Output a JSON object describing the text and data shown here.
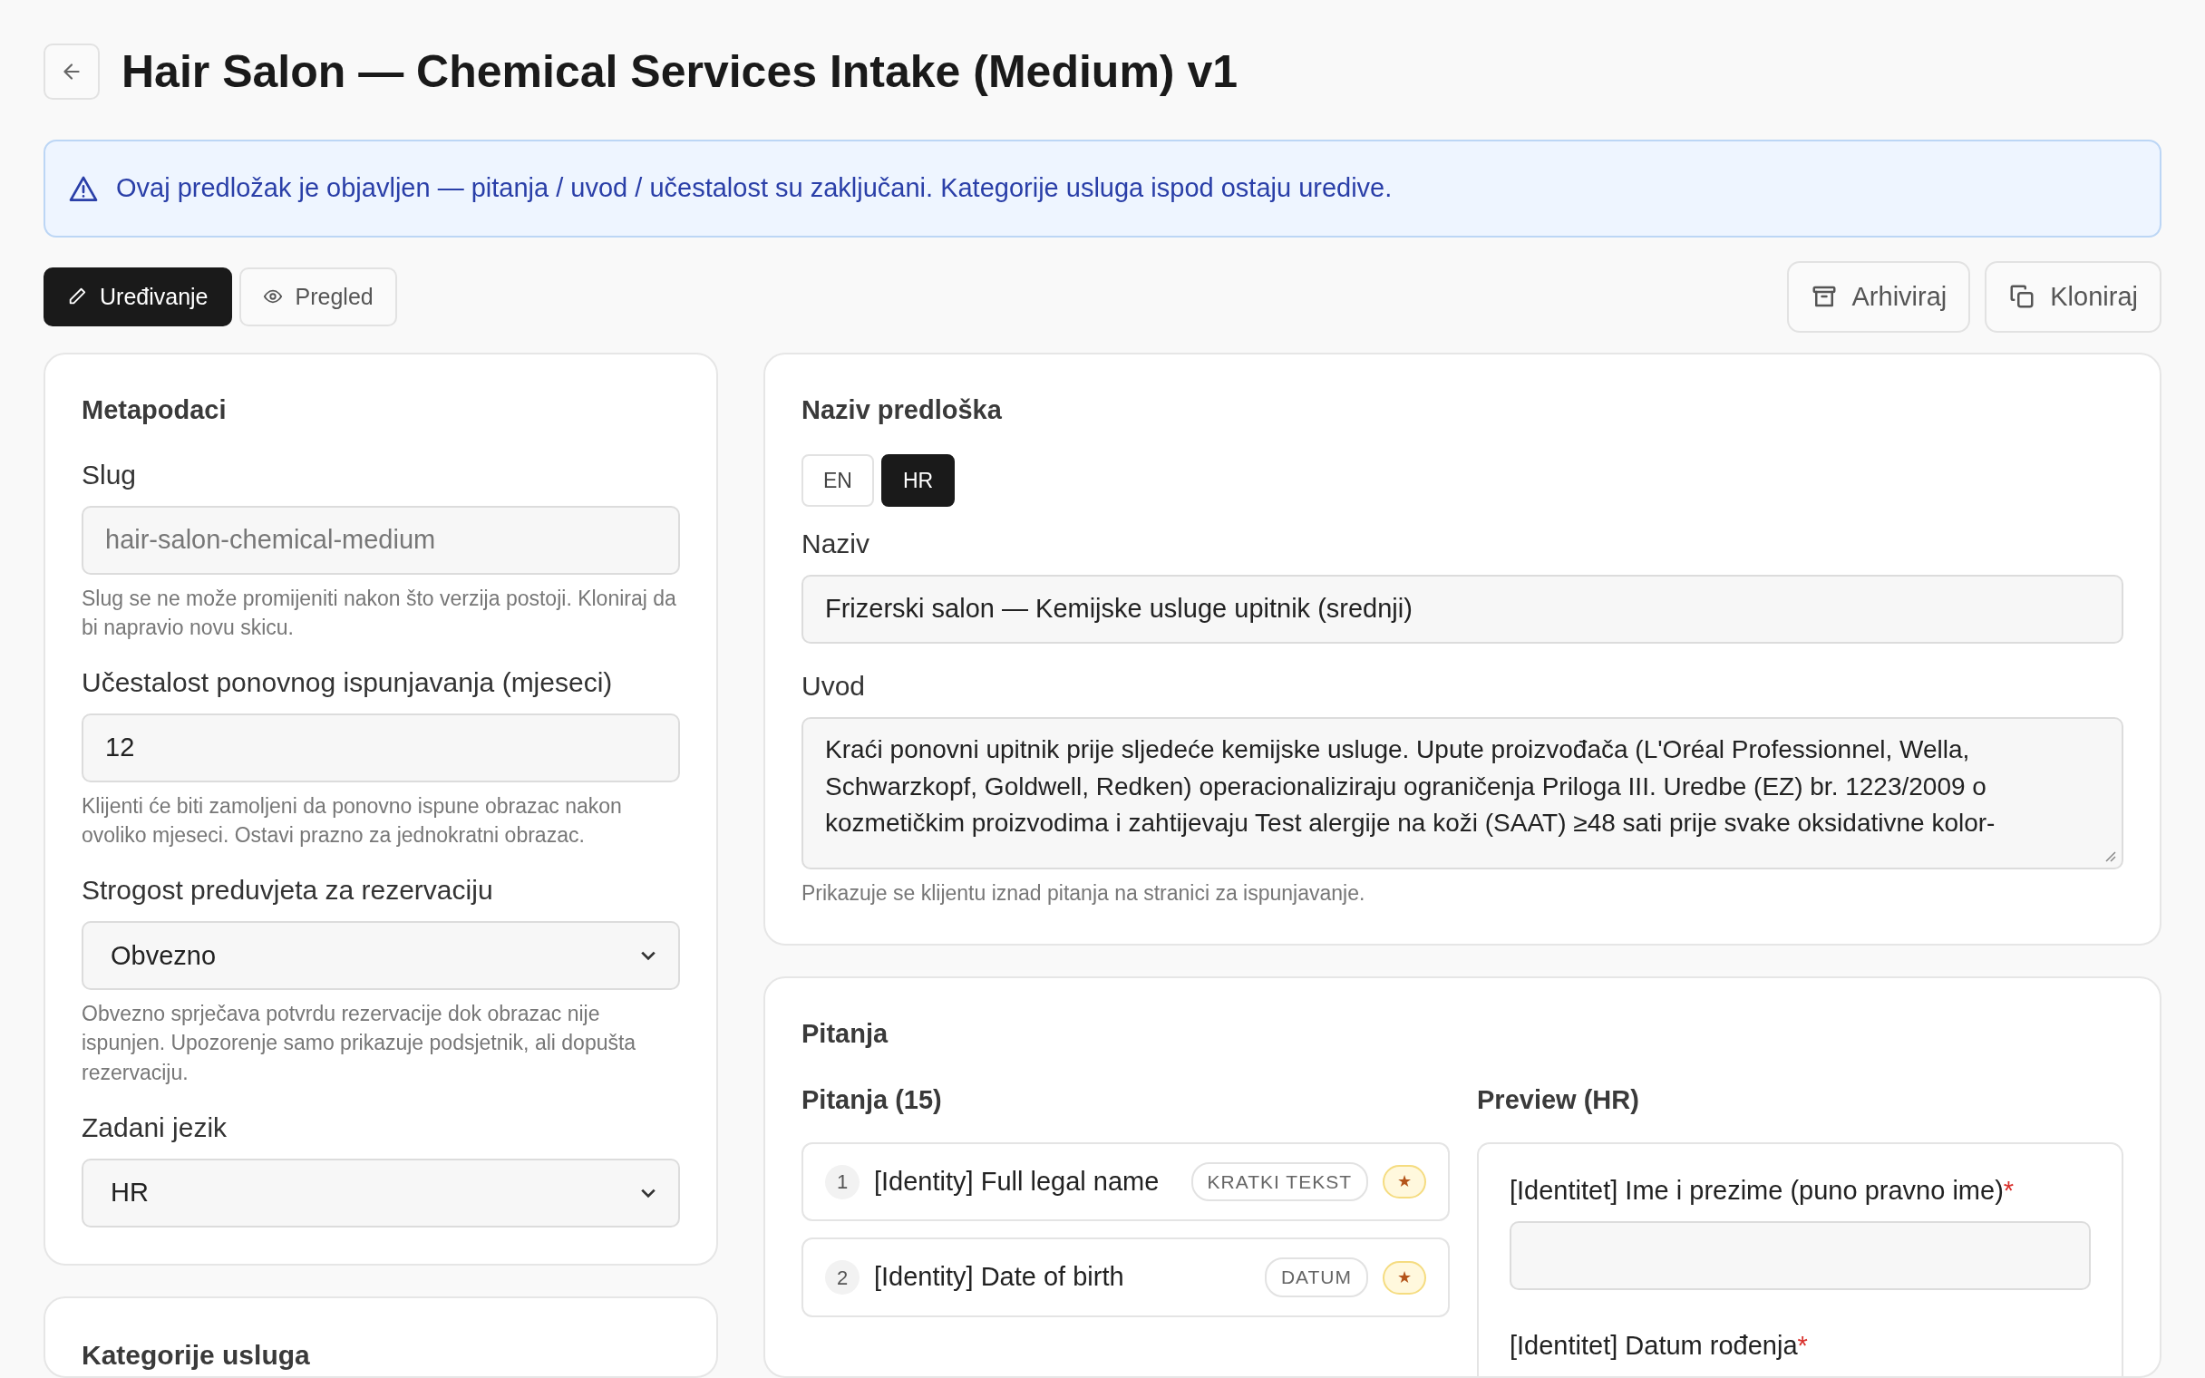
{
  "header": {
    "title": "Hair Salon — Chemical Services Intake (Medium) v1"
  },
  "alert": {
    "text": "Ovaj predložak je objavljen — pitanja / uvod / učestalost su zaključani. Kategorije usluga ispod ostaju uredive."
  },
  "mode_tabs": [
    {
      "label": "Uređivanje",
      "selected": true
    },
    {
      "label": "Pregled",
      "selected": false
    }
  ],
  "actions": [
    {
      "label": "Arhiviraj"
    },
    {
      "label": "Kloniraj"
    }
  ],
  "metadata": {
    "title": "Metapodaci",
    "fields": [
      {
        "kind": "input",
        "label": "Slug",
        "value": "hair-salon-chemical-medium",
        "disabled": true,
        "help": "Slug se ne može promijeniti nakon što verzija postoji. Kloniraj da bi napravio novu skicu."
      },
      {
        "kind": "input",
        "label": "Učestalost ponovnog ispunjavanja (mjeseci)",
        "value": "12",
        "help": "Klijenti će biti zamoljeni da ponovno ispune obrazac nakon ovoliko mjeseci. Ostavi prazno za jednokratni obrazac."
      },
      {
        "kind": "select",
        "label": "Strogost preduvjeta za rezervaciju",
        "value": "Obvezno",
        "help": "Obvezno sprječava potvrdu rezervacije dok obrazac nije ispunjen. Upozorenje samo prikazuje podsjetnik, ali dopušta rezervaciju."
      },
      {
        "kind": "select",
        "label": "Zadani jezik",
        "value": "HR"
      }
    ]
  },
  "categories": {
    "title": "Kategorije usluga"
  },
  "template_name": {
    "title": "Naziv predloška",
    "languages": [
      {
        "label": "EN",
        "selected": false
      },
      {
        "label": "HR",
        "selected": true
      }
    ],
    "name_label": "Naziv",
    "name_value": "Frizerski salon — Kemijske usluge upitnik (srednji)",
    "intro_label": "Uvod",
    "intro_value": "Kraći ponovni upitnik prije sljedeće kemijske usluge. Upute proizvođača (L'Oréal Professionnel, Wella, Schwarzkopf, Goldwell, Redken) operacionaliziraju ograničenja Priloga III. Uredbe (EZ) br. 1223/2009 o kozmetičkim proizvodima i zahtijevaju Test alergije na koži (SAAT) ≥48 sati prije svake oksidativne kolor-",
    "intro_help": "Prikazuje se klijentu iznad pitanja na stranici za ispunjavanje."
  },
  "questions": {
    "title": "Pitanja",
    "list_title": "Pitanja (15)",
    "items": [
      {
        "number": "1",
        "label": "[Identity] Full legal name",
        "type": "KRATKI TEKST",
        "required": true,
        "star": "★"
      },
      {
        "number": "2",
        "label": "[Identity] Date of birth",
        "type": "DATUM",
        "required": true,
        "star": "★"
      }
    ],
    "preview_title": "Preview (HR)",
    "preview_fields": [
      {
        "label": "[Identitet] Ime i prezime (puno pravno ime)",
        "required": true,
        "mark": "*"
      },
      {
        "label": "[Identitet] Datum rođenja",
        "required": true,
        "mark": "*"
      }
    ]
  }
}
